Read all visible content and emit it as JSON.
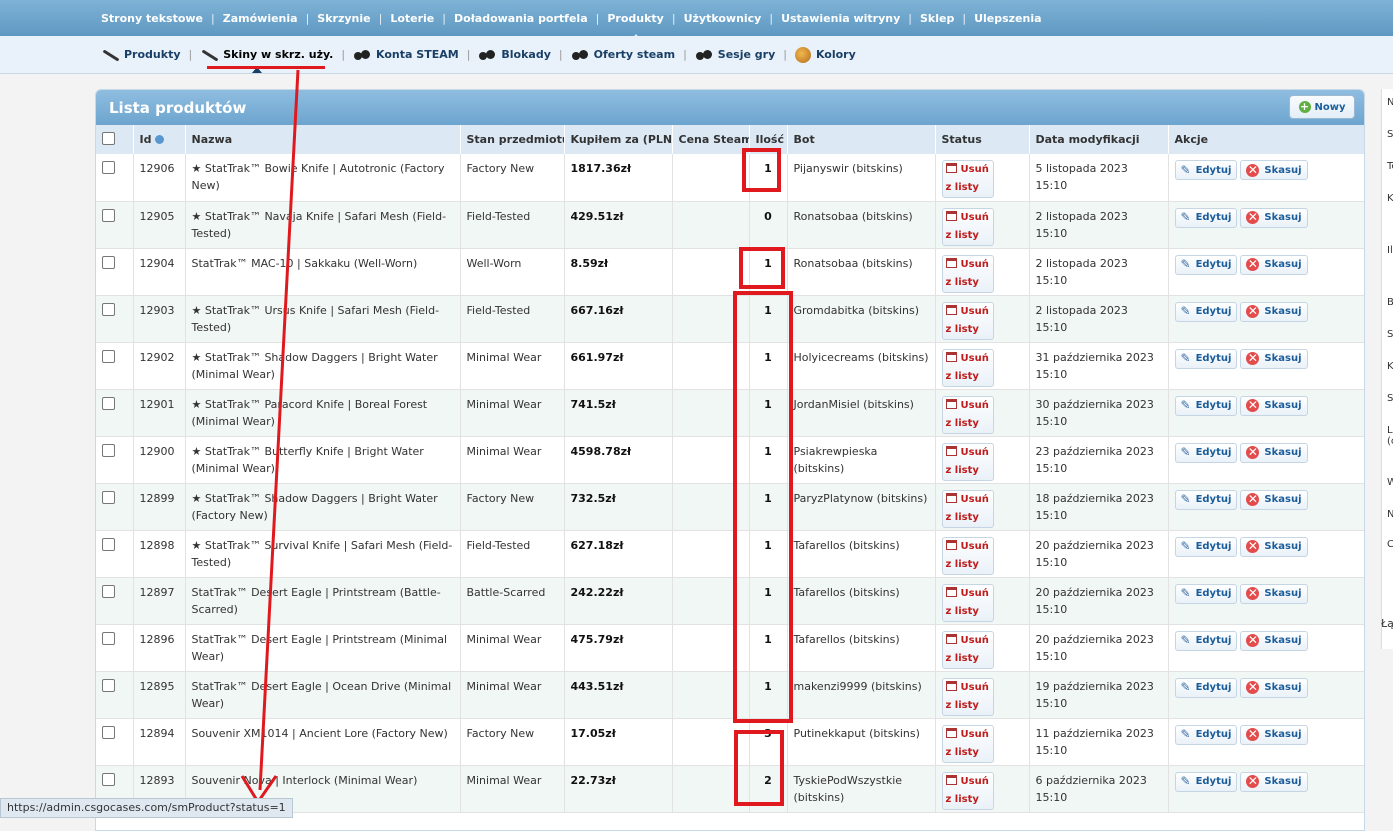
{
  "top_nav": {
    "items": [
      "Strony tekstowe",
      "Zamówienia",
      "Skrzynie",
      "Loterie",
      "Doładowania portfela",
      "Produkty",
      "Użytkownicy",
      "Ustawienia witryny",
      "Sklep",
      "Ulepszenia"
    ],
    "active": "Produkty"
  },
  "sub_nav": {
    "items": [
      {
        "label": "Produkty",
        "icon": "knife-icon"
      },
      {
        "label": "Skiny w skrz. uży.",
        "icon": "knife-icon"
      },
      {
        "label": "Konta STEAM",
        "icon": "gloves-icon"
      },
      {
        "label": "Blokady",
        "icon": "gloves-icon"
      },
      {
        "label": "Oferty steam",
        "icon": "gloves-icon"
      },
      {
        "label": "Sesje gry",
        "icon": "gloves-icon"
      },
      {
        "label": "Kolory",
        "icon": "palette-icon"
      }
    ],
    "active": "Skiny w skrz. uży."
  },
  "panel": {
    "title": "Lista produktów",
    "new_button": "Nowy"
  },
  "table": {
    "headers": {
      "id": "Id",
      "name": "Nazwa",
      "condition": "Stan przedmiotu",
      "bought": "Kupiłem za (PLN)",
      "steam": "Cena Steam",
      "qty": "Ilość",
      "bot": "Bot",
      "status": "Status",
      "modified": "Data modyfikacji",
      "actions": "Akcje"
    },
    "remove_label": "Usuń z listy",
    "edit_label": "Edytuj",
    "delete_label": "Skasuj",
    "rows": [
      {
        "id": "12906",
        "name": "★ StatTrak™ Bowie Knife | Autotronic (Factory New)",
        "condition": "Factory New",
        "price": "1817.36zł",
        "steam": "",
        "qty": "1",
        "bot": "Pijanyswir (bitskins)",
        "date": "5 listopada 2023 15:10"
      },
      {
        "id": "12905",
        "name": "★ StatTrak™ Navaja Knife | Safari Mesh (Field-Tested)",
        "condition": "Field-Tested",
        "price": "429.51zł",
        "steam": "",
        "qty": "0",
        "bot": "Ronatsobaa (bitskins)",
        "date": "2 listopada 2023 15:10"
      },
      {
        "id": "12904",
        "name": "StatTrak™ MAC-10 | Sakkaku (Well-Worn)",
        "condition": "Well-Worn",
        "price": "8.59zł",
        "steam": "",
        "qty": "1",
        "bot": "Ronatsobaa (bitskins)",
        "date": "2 listopada 2023 15:10"
      },
      {
        "id": "12903",
        "name": "★ StatTrak™ Ursus Knife | Safari Mesh (Field-Tested)",
        "condition": "Field-Tested",
        "price": "667.16zł",
        "steam": "",
        "qty": "1",
        "bot": "Gromdabitka (bitskins)",
        "date": "2 listopada 2023 15:10"
      },
      {
        "id": "12902",
        "name": "★ StatTrak™ Shadow Daggers | Bright Water (Minimal Wear)",
        "condition": "Minimal Wear",
        "price": "661.97zł",
        "steam": "",
        "qty": "1",
        "bot": "Holyicecreams (bitskins)",
        "date": "31 października 2023 15:10"
      },
      {
        "id": "12901",
        "name": "★ StatTrak™ Paracord Knife | Boreal Forest (Minimal Wear)",
        "condition": "Minimal Wear",
        "price": "741.5zł",
        "steam": "",
        "qty": "1",
        "bot": "JordanMisiel (bitskins)",
        "date": "30 października 2023 15:10"
      },
      {
        "id": "12900",
        "name": "★ StatTrak™ Butterfly Knife | Bright Water (Minimal Wear)",
        "condition": "Minimal Wear",
        "price": "4598.78zł",
        "steam": "",
        "qty": "1",
        "bot": "Psiakrewpieska (bitskins)",
        "date": "23 października 2023 15:10"
      },
      {
        "id": "12899",
        "name": "★ StatTrak™ Shadow Daggers | Bright Water (Factory New)",
        "condition": "Factory New",
        "price": "732.5zł",
        "steam": "",
        "qty": "1",
        "bot": "ParyzPlatynow (bitskins)",
        "date": "18 października 2023 15:10"
      },
      {
        "id": "12898",
        "name": "★ StatTrak™ Survival Knife | Safari Mesh (Field-Tested)",
        "condition": "Field-Tested",
        "price": "627.18zł",
        "steam": "",
        "qty": "1",
        "bot": "Tafarellos (bitskins)",
        "date": "20 października 2023 15:10"
      },
      {
        "id": "12897",
        "name": "StatTrak™ Desert Eagle | Printstream (Battle-Scarred)",
        "condition": "Battle-Scarred",
        "price": "242.22zł",
        "steam": "",
        "qty": "1",
        "bot": "Tafarellos (bitskins)",
        "date": "20 października 2023 15:10"
      },
      {
        "id": "12896",
        "name": "StatTrak™ Desert Eagle | Printstream (Minimal Wear)",
        "condition": "Minimal Wear",
        "price": "475.79zł",
        "steam": "",
        "qty": "1",
        "bot": "Tafarellos (bitskins)",
        "date": "20 października 2023 15:10"
      },
      {
        "id": "12895",
        "name": "StatTrak™ Desert Eagle | Ocean Drive (Minimal Wear)",
        "condition": "Minimal Wear",
        "price": "443.51zł",
        "steam": "",
        "qty": "1",
        "bot": "makenzi9999 (bitskins)",
        "date": "19 października 2023 15:10"
      },
      {
        "id": "12894",
        "name": "Souvenir XM1014 | Ancient Lore (Factory New)",
        "condition": "Factory New",
        "price": "17.05zł",
        "steam": "",
        "qty": "3",
        "bot": "Putinekkaput (bitskins)",
        "date": "11 października 2023 15:10"
      },
      {
        "id": "12893",
        "name": "Souvenir Nova | Interlock (Minimal Wear)",
        "condition": "Minimal Wear",
        "price": "22.73zł",
        "steam": "",
        "qty": "2",
        "bot": "TyskiePodWszystkie (bitskins)",
        "date": "6 października 2023 15:10"
      }
    ]
  },
  "side_panel_letters": [
    "N",
    "S",
    "Te",
    "K",
    "Il",
    "B",
    "S",
    "K",
    "S",
    "Li (c",
    "W",
    "N",
    "C"
  ],
  "side_footer": "Łą",
  "status_bar_url": "https://admin.csgocases.com/smProduct?status=1",
  "annotation_color": "#e0191f"
}
